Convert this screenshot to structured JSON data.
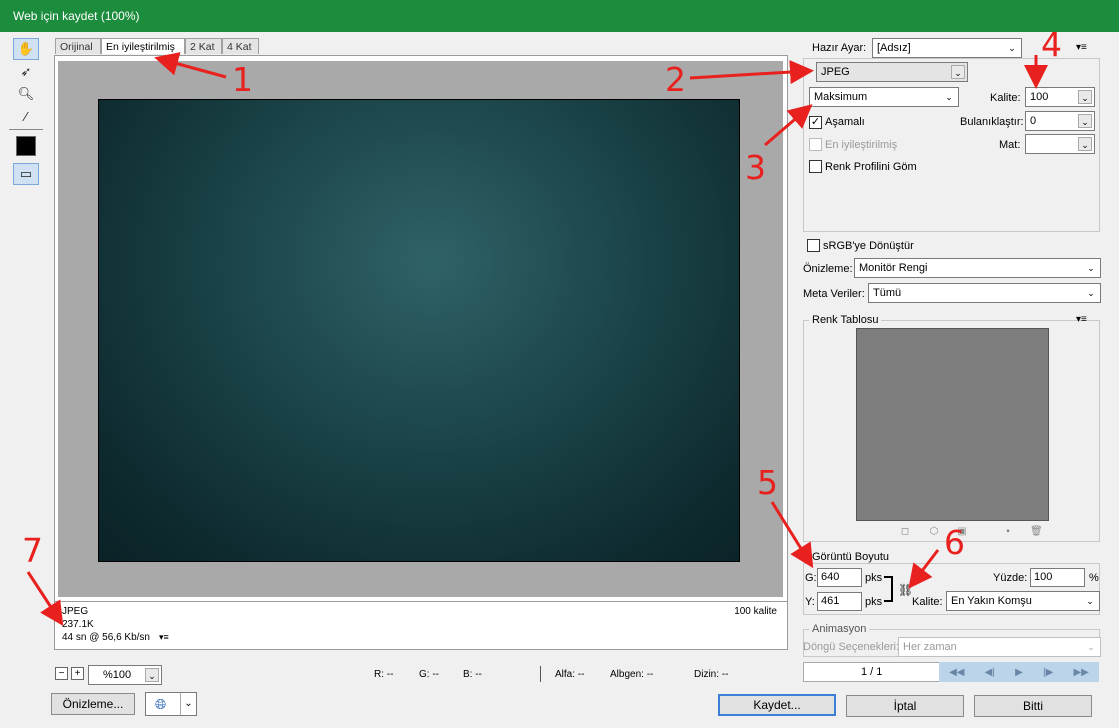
{
  "window": {
    "title": "Web için kaydet (100%)"
  },
  "tools": [
    "hand-icon",
    "slice-select-icon",
    "zoom-icon",
    "eyedropper-icon",
    "color-swatch",
    "toggle-slices-icon"
  ],
  "tabs": [
    {
      "label": "Orijinal"
    },
    {
      "label": "En iyileştirilmiş"
    },
    {
      "label": "2 Kat"
    },
    {
      "label": "4 Kat"
    }
  ],
  "preview": {
    "format": "JPEG",
    "size": "237.1K",
    "time": "44 sn @ 56,6 Kb/sn",
    "quality": "100 kalite"
  },
  "zoom": {
    "value": "%100",
    "minus": "−",
    "plus": "+"
  },
  "status": {
    "r": "R: --",
    "g": "G: --",
    "b": "B: --",
    "alpha": "Alfa: --",
    "hex": "Albgen: --",
    "index": "Dizin: --"
  },
  "settings": {
    "preset_label": "Hazır Ayar:",
    "preset_value": "[Adsız]",
    "format_value": "JPEG",
    "compression_value": "Maksimum",
    "quality_label": "Kalite:",
    "quality_value": "100",
    "progressive_label": "Aşamalı",
    "progressive_checked": "✓",
    "blur_label": "Bulanıklaştır:",
    "blur_value": "0",
    "optimized_label": "En iyileştirilmiş",
    "matte_label": "Mat:",
    "embed_profile_label": "Renk Profilini Göm",
    "srgb_label": "sRGB'ye Dönüştür",
    "preview_label": "Önizleme:",
    "preview_value": "Monitör Rengi",
    "metadata_label": "Meta Veriler:",
    "metadata_value": "Tümü"
  },
  "color_table": {
    "title": "Renk Tablosu"
  },
  "image_size": {
    "title": "Görüntü Boyutu",
    "w_label": "G:",
    "w_value": "640",
    "h_label": "Y:",
    "h_value": "461",
    "unit": "pks",
    "percent_label": "Yüzde:",
    "percent_value": "100",
    "percent_unit": "%",
    "quality_label": "Kalite:",
    "quality_value": "En Yakın Komşu"
  },
  "animation": {
    "title": "Animasyon",
    "loop_label": "Döngü Seçenekleri:",
    "loop_value": "Her zaman",
    "frame": "1 / 1"
  },
  "buttons": {
    "preview": "Önizleme...",
    "save": "Kaydet...",
    "cancel": "İptal",
    "done": "Bitti"
  },
  "annotations": [
    "1",
    "2",
    "3",
    "4",
    "5",
    "6",
    "7"
  ],
  "colors": {
    "titlebar": "#1c8c3d",
    "annotation": "#e8201e",
    "accent": "#3c7fd4"
  }
}
